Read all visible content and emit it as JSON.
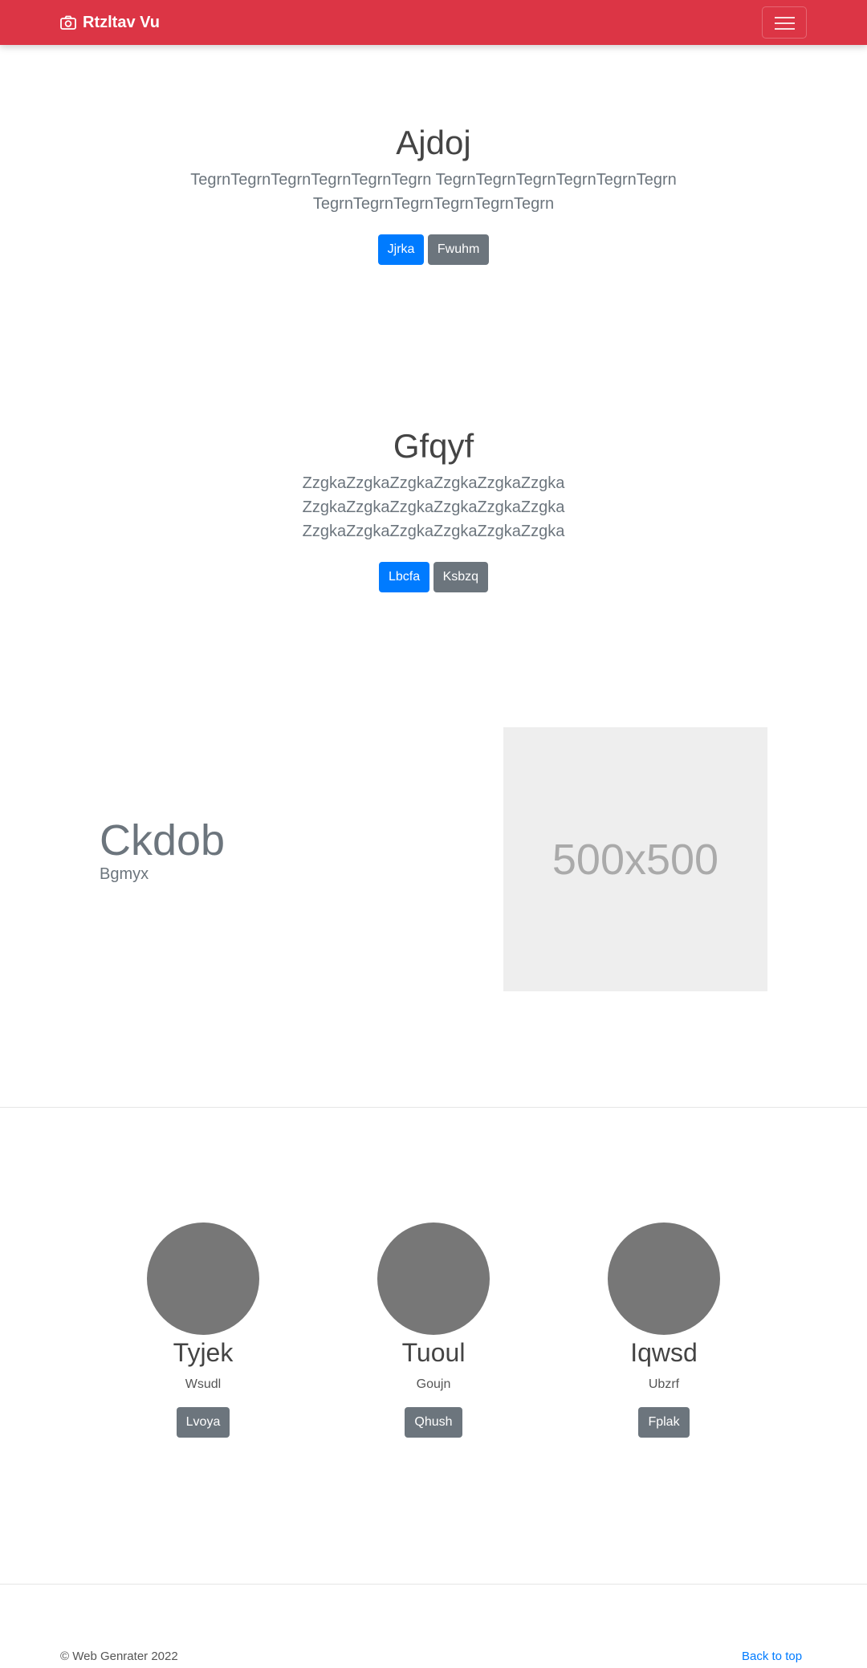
{
  "navbar": {
    "brand": "Rtzltav Vu",
    "brand_icon": "camera-icon",
    "toggler_icon": "hamburger-icon",
    "color": "#dc3545"
  },
  "hero1": {
    "title": "Ajdoj",
    "lines": [
      "TegrnTegrnTegrnTegrnTegrnTegrn TegrnTegrnTegrnTegrnTegrnTegrn",
      "TegrnTegrnTegrnTegrnTegrnTegrn"
    ],
    "primary_btn": "Jjrka",
    "secondary_btn": "Fwuhm"
  },
  "hero2": {
    "title": "Gfqyf",
    "lines": [
      "ZzgkaZzgkaZzgkaZzgkaZzgkaZzgka",
      "ZzgkaZzgkaZzgkaZzgkaZzgkaZzgka",
      "ZzgkaZzgkaZzgkaZzgkaZzgkaZzgka"
    ],
    "primary_btn": "Lbcfa",
    "secondary_btn": "Ksbzq"
  },
  "feature": {
    "title": "Ckdob",
    "subtitle": "Bgmyx",
    "image_label": "500x500"
  },
  "columns": [
    {
      "title": "Tyjek",
      "text": "Wsudl",
      "button": "Lvoya"
    },
    {
      "title": "Tuoul",
      "text": "Goujn",
      "button": "Qhush"
    },
    {
      "title": "Iqwsd",
      "text": "Ubzrf",
      "button": "Fplak"
    }
  ],
  "footer": {
    "copyright": "© Web Genrater 2022",
    "back_to_top": "Back to top"
  },
  "colors": {
    "primary": "#007bff",
    "secondary": "#6c757d",
    "navbar": "#dc3545"
  }
}
